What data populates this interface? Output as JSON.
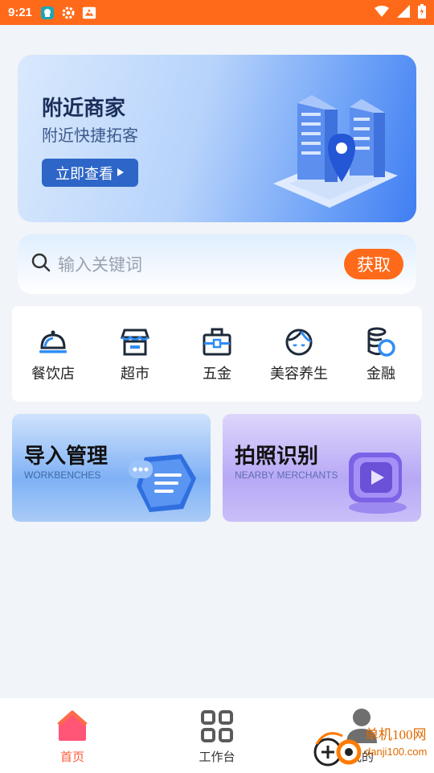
{
  "status_bar": {
    "time": "9:21",
    "icons_left": [
      "app-notification-icon",
      "settings-gear-icon",
      "photo-icon"
    ],
    "icons_right": [
      "wifi-icon",
      "signal-icon",
      "battery-icon"
    ],
    "bar_color": "#ff6a1a"
  },
  "banner": {
    "title": "附近商家",
    "subtitle": "附近快捷拓客",
    "button_label": "立即查看",
    "button_icon": "play-triangle-icon"
  },
  "search": {
    "placeholder": "输入关键词",
    "button_label": "获取",
    "accent": "#ff6a1a"
  },
  "categories": [
    {
      "label": "餐饮店",
      "icon": "restaurant-cloche-icon"
    },
    {
      "label": "超市",
      "icon": "supermarket-store-icon"
    },
    {
      "label": "五金",
      "icon": "toolbox-icon"
    },
    {
      "label": "美容养生",
      "icon": "beauty-face-icon"
    },
    {
      "label": "金融",
      "icon": "finance-coins-icon"
    }
  ],
  "cards": [
    {
      "title": "导入管理",
      "subtitle": "WORKBENCHES",
      "icon": "chat-import-icon"
    },
    {
      "title": "拍照识别",
      "subtitle": "NEARBY MERCHANTS",
      "icon": "video-play-icon"
    }
  ],
  "tabbar": {
    "items": [
      {
        "label": "首页",
        "icon": "home-icon",
        "active": true
      },
      {
        "label": "工作台",
        "icon": "grid-apps-icon",
        "active": false
      },
      {
        "label": "我的",
        "icon": "user-profile-icon",
        "active": false
      }
    ],
    "active_color": "#ff5a3a"
  },
  "watermark": {
    "text": "单机100网",
    "url_text": "danji100.com"
  }
}
